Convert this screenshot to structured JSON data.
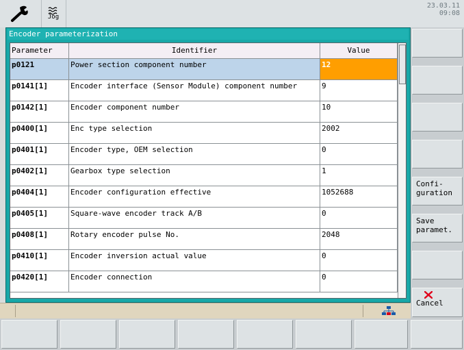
{
  "topbar": {
    "jog_label": "Jog",
    "date": "23.03.11",
    "time": "09:08"
  },
  "dialog": {
    "title": "Encoder parameterization"
  },
  "table": {
    "headers": {
      "param": "Parameter",
      "ident": "Identifier",
      "value": "Value"
    },
    "rows": [
      {
        "param": "p0121",
        "ident": "Power section component number",
        "value": "12"
      },
      {
        "param": "p0141[1]",
        "ident": "Encoder interface (Sensor Module) component number",
        "value": "9"
      },
      {
        "param": "p0142[1]",
        "ident": "Encoder component number",
        "value": "10"
      },
      {
        "param": "p0400[1]",
        "ident": "Enc type selection",
        "value": "2002"
      },
      {
        "param": "p0401[1]",
        "ident": "Encoder type, OEM selection",
        "value": "0"
      },
      {
        "param": "p0402[1]",
        "ident": "Gearbox type selection",
        "value": "1"
      },
      {
        "param": "p0404[1]",
        "ident": "Encoder configuration effective",
        "value": "1052688"
      },
      {
        "param": "p0405[1]",
        "ident": "Square-wave encoder track A/B",
        "value": "0"
      },
      {
        "param": "p0408[1]",
        "ident": "Rotary encoder pulse No.",
        "value": "2048"
      },
      {
        "param": "p0410[1]",
        "ident": "Encoder inversion actual value",
        "value": "0"
      },
      {
        "param": "p0420[1]",
        "ident": "Encoder connection",
        "value": "0"
      }
    ]
  },
  "softkeys": {
    "configuration": [
      "Confi-",
      "guration"
    ],
    "save": [
      "Save",
      "paramet."
    ],
    "cancel": "Cancel"
  },
  "colors": {
    "dialog": "#18a8a8",
    "selected_value": "#ff9e00",
    "selected_row": "#bdd4ea",
    "cancel_x": "#e0001a"
  },
  "icons": {
    "wrench": "wrench-icon",
    "jog": "jog-icon",
    "network": "network-icon",
    "cancel": "cancel-x-icon"
  }
}
